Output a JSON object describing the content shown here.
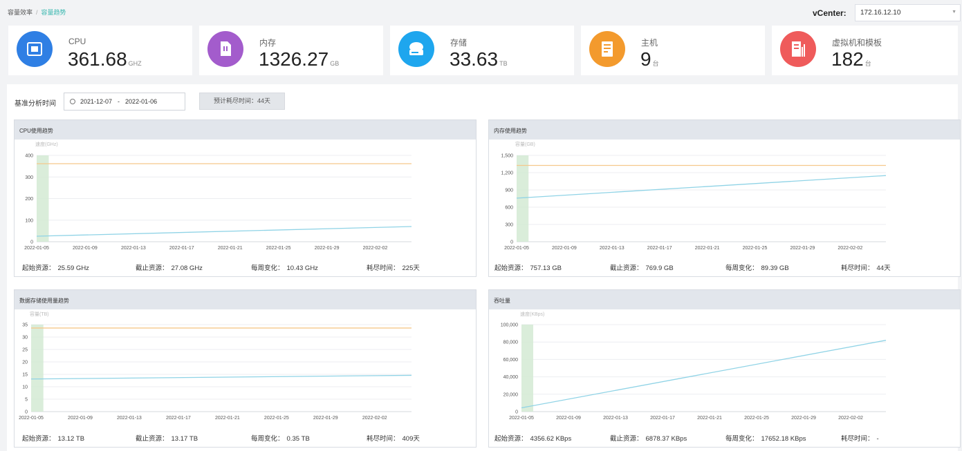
{
  "breadcrumb": {
    "parent": "容量效率",
    "current": "容量趋势"
  },
  "vcenter": {
    "label": "vCenter:",
    "value": "172.16.12.10"
  },
  "colors": {
    "accent": "#3bb8b0",
    "capacity_line": "#f5c88a",
    "usage_line": "#8fd3e6",
    "baseline_band": "#d4ead3"
  },
  "summary_cards": [
    {
      "label": "CPU",
      "value": "361.68",
      "unit": "GHZ",
      "icon": "cpu-icon",
      "color": "#2f7fe4"
    },
    {
      "label": "内存",
      "value": "1326.27",
      "unit": "GB",
      "icon": "memory-icon",
      "color": "#a35ccc"
    },
    {
      "label": "存储",
      "value": "33.63",
      "unit": "TB",
      "icon": "storage-icon",
      "color": "#1ea6ee"
    },
    {
      "label": "主机",
      "value": "9",
      "unit": "台",
      "icon": "host-icon",
      "color": "#f39a2d"
    },
    {
      "label": "虚拟机和模板",
      "value": "182",
      "unit": "台",
      "icon": "vm-template-icon",
      "color": "#ef5b5b"
    }
  ],
  "analysis": {
    "label": "基准分析时间",
    "start": "2021-12-07",
    "separator": "-",
    "end": "2022-01-06",
    "estimate_button": "预计耗尽时间：44天"
  },
  "charts": [
    {
      "title": "CPU使用趋势",
      "unit_label": "速度(GHz)",
      "stats": [
        {
          "key": "起始资源：",
          "value": "25.59 GHz"
        },
        {
          "key": "截止资源：",
          "value": "27.08 GHz"
        },
        {
          "key": "每周变化：",
          "value": "10.43 GHz"
        },
        {
          "key": "耗尽时间：",
          "value": "225天"
        }
      ]
    },
    {
      "title": "内存使用趋势",
      "unit_label": "容量(GB)",
      "stats": [
        {
          "key": "起始资源：",
          "value": "757.13 GB"
        },
        {
          "key": "截止资源：",
          "value": "769.9 GB"
        },
        {
          "key": "每周变化：",
          "value": "89.39 GB"
        },
        {
          "key": "耗尽时间：",
          "value": "44天"
        }
      ]
    },
    {
      "title": "数据存储使用量趋势",
      "unit_label": "容量(TB)",
      "stats": [
        {
          "key": "起始资源：",
          "value": "13.12 TB"
        },
        {
          "key": "截止资源：",
          "value": "13.17 TB"
        },
        {
          "key": "每周变化：",
          "value": "0.35 TB"
        },
        {
          "key": "耗尽时间：",
          "value": "409天"
        }
      ]
    },
    {
      "title": "吞吐量",
      "unit_label": "速度(KBps)",
      "stats": [
        {
          "key": "起始资源：",
          "value": "4356.62 KBps"
        },
        {
          "key": "截止资源：",
          "value": "6878.37 KBps"
        },
        {
          "key": "每周变化：",
          "value": "17652.18 KBps"
        },
        {
          "key": "耗尽时间：",
          "value": "-"
        }
      ]
    }
  ],
  "chart_data": [
    {
      "type": "line",
      "title": "CPU使用趋势",
      "ylabel": "速度(GHz)",
      "ylim": [
        0,
        400
      ],
      "yticks": [
        "0",
        "100",
        "200",
        "300",
        "400"
      ],
      "x": [
        "2022-01-05",
        "2022-01-09",
        "2022-01-13",
        "2022-01-17",
        "2022-01-21",
        "2022-01-25",
        "2022-01-29",
        "2022-02-02"
      ],
      "x_start": "2022-01-05",
      "x_end": "2022-02-05",
      "baseline_band": [
        "2022-01-05",
        "2022-01-06"
      ],
      "series": [
        {
          "role": "capacity",
          "values": [
            361.68,
            361.68
          ]
        },
        {
          "role": "usage",
          "values": [
            25.59,
            70.3
          ]
        }
      ]
    },
    {
      "type": "line",
      "title": "内存使用趋势",
      "ylabel": "容量(GB)",
      "ylim": [
        0,
        1500
      ],
      "yticks": [
        "0",
        "300",
        "600",
        "900",
        "1,200",
        "1,500"
      ],
      "x": [
        "2022-01-05",
        "2022-01-09",
        "2022-01-13",
        "2022-01-17",
        "2022-01-21",
        "2022-01-25",
        "2022-01-29",
        "2022-02-02"
      ],
      "x_start": "2022-01-05",
      "x_end": "2022-02-05",
      "baseline_band": [
        "2022-01-05",
        "2022-01-06"
      ],
      "series": [
        {
          "role": "capacity",
          "values": [
            1326.27,
            1326.27
          ]
        },
        {
          "role": "usage",
          "values": [
            757.13,
            1150
          ]
        }
      ]
    },
    {
      "type": "line",
      "title": "数据存储使用量趋势",
      "ylabel": "容量(TB)",
      "ylim": [
        0,
        35
      ],
      "yticks": [
        "0",
        "5",
        "10",
        "15",
        "20",
        "25",
        "30",
        "35"
      ],
      "x": [
        "2022-01-05",
        "2022-01-09",
        "2022-01-13",
        "2022-01-17",
        "2022-01-21",
        "2022-01-25",
        "2022-01-29",
        "2022-02-02"
      ],
      "x_start": "2022-01-05",
      "x_end": "2022-02-05",
      "baseline_band": [
        "2022-01-05",
        "2022-01-06"
      ],
      "series": [
        {
          "role": "capacity",
          "values": [
            33.63,
            33.63
          ]
        },
        {
          "role": "usage",
          "values": [
            13.12,
            14.6
          ]
        }
      ]
    },
    {
      "type": "line",
      "title": "吞吐量",
      "ylabel": "速度(KBps)",
      "ylim": [
        0,
        100000
      ],
      "yticks": [
        "0",
        "20,000",
        "40,000",
        "60,000",
        "80,000",
        "100,000"
      ],
      "x": [
        "2022-01-05",
        "2022-01-09",
        "2022-01-13",
        "2022-01-17",
        "2022-01-21",
        "2022-01-25",
        "2022-01-29",
        "2022-02-02"
      ],
      "x_start": "2022-01-05",
      "x_end": "2022-02-05",
      "baseline_band": [
        "2022-01-05",
        "2022-01-06"
      ],
      "series": [
        {
          "role": "usage",
          "values": [
            4356.62,
            82000
          ]
        }
      ]
    }
  ]
}
